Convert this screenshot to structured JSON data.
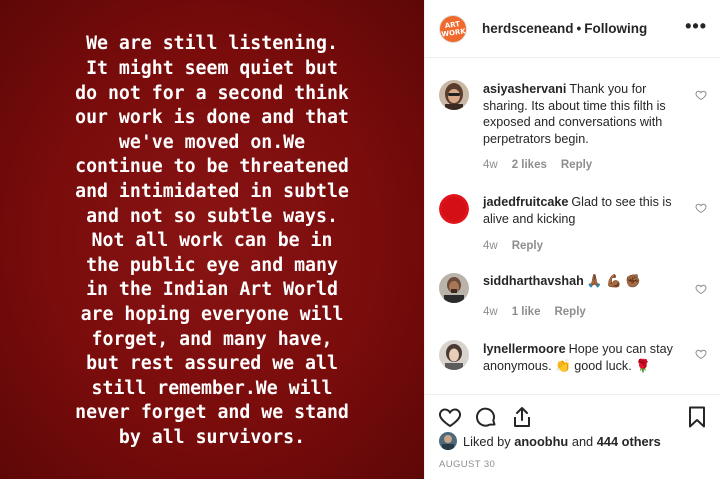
{
  "post": {
    "text": "We are still listening.\nIt might seem quiet but\ndo not for a second think\nour work is done and that\nwe've moved on.We\ncontinue to be threatened\nand intimidated in subtle\nand not so subtle ways.\nNot all work can be in\nthe public eye and many\nin the Indian Art World\nare hoping everyone will\nforget, and many have,\nbut rest assured we all\nstill remember.We will\nnever forget and we stand\nby all survivors.",
    "background_color": "#7a0c0c"
  },
  "header": {
    "avatar_text": "ART WORK",
    "username": "herdsceneand",
    "separator": "•",
    "follow_status": "Following",
    "more_label": "•••"
  },
  "comments": [
    {
      "username": "asiyashervani",
      "text": "Thank you for sharing. Its about time this filth is exposed and conversations with perpetrators begin.",
      "age": "4w",
      "likes": "2 likes",
      "reply": "Reply"
    },
    {
      "username": "jadedfruitcake",
      "text": "Glad to see this is alive and kicking",
      "age": "4w",
      "reply": "Reply"
    },
    {
      "username": "siddharthavshah",
      "text": "🙏🏾 💪🏾 ✊🏾",
      "age": "4w",
      "likes": "1 like",
      "reply": "Reply"
    },
    {
      "username": "lynellermoore",
      "text": "Hope you can stay anonymous. 👏 good luck. 🌹",
      "age": "",
      "reply": ""
    }
  ],
  "likes": {
    "prefix": "Liked by",
    "user": "anoobhu",
    "connector": "and",
    "others": "444 others"
  },
  "date": "AUGUST 30",
  "icons": [
    "heart-icon",
    "comment-icon",
    "share-icon",
    "bookmark-icon",
    "more-icon"
  ]
}
